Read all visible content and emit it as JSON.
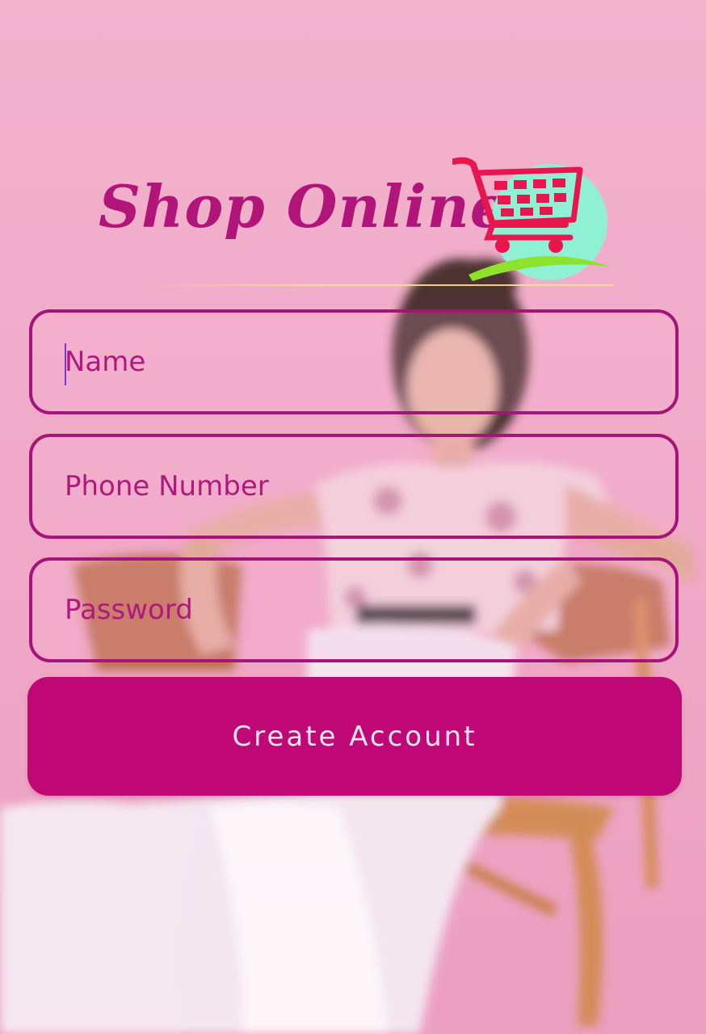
{
  "logo": {
    "text": "Shop Online",
    "icon": "shopping-cart-icon"
  },
  "form": {
    "name_placeholder": "Name",
    "phone_placeholder": "Phone Number",
    "password_placeholder": "Password",
    "create_account_label": "Create Account"
  },
  "colors": {
    "accent": "#bf0776",
    "field_border": "#a6147a",
    "background": "#f1b4cc",
    "cart": "#e8164f",
    "cart_circle": "#8ff0d4",
    "cart_swoosh": "#8de22a"
  }
}
